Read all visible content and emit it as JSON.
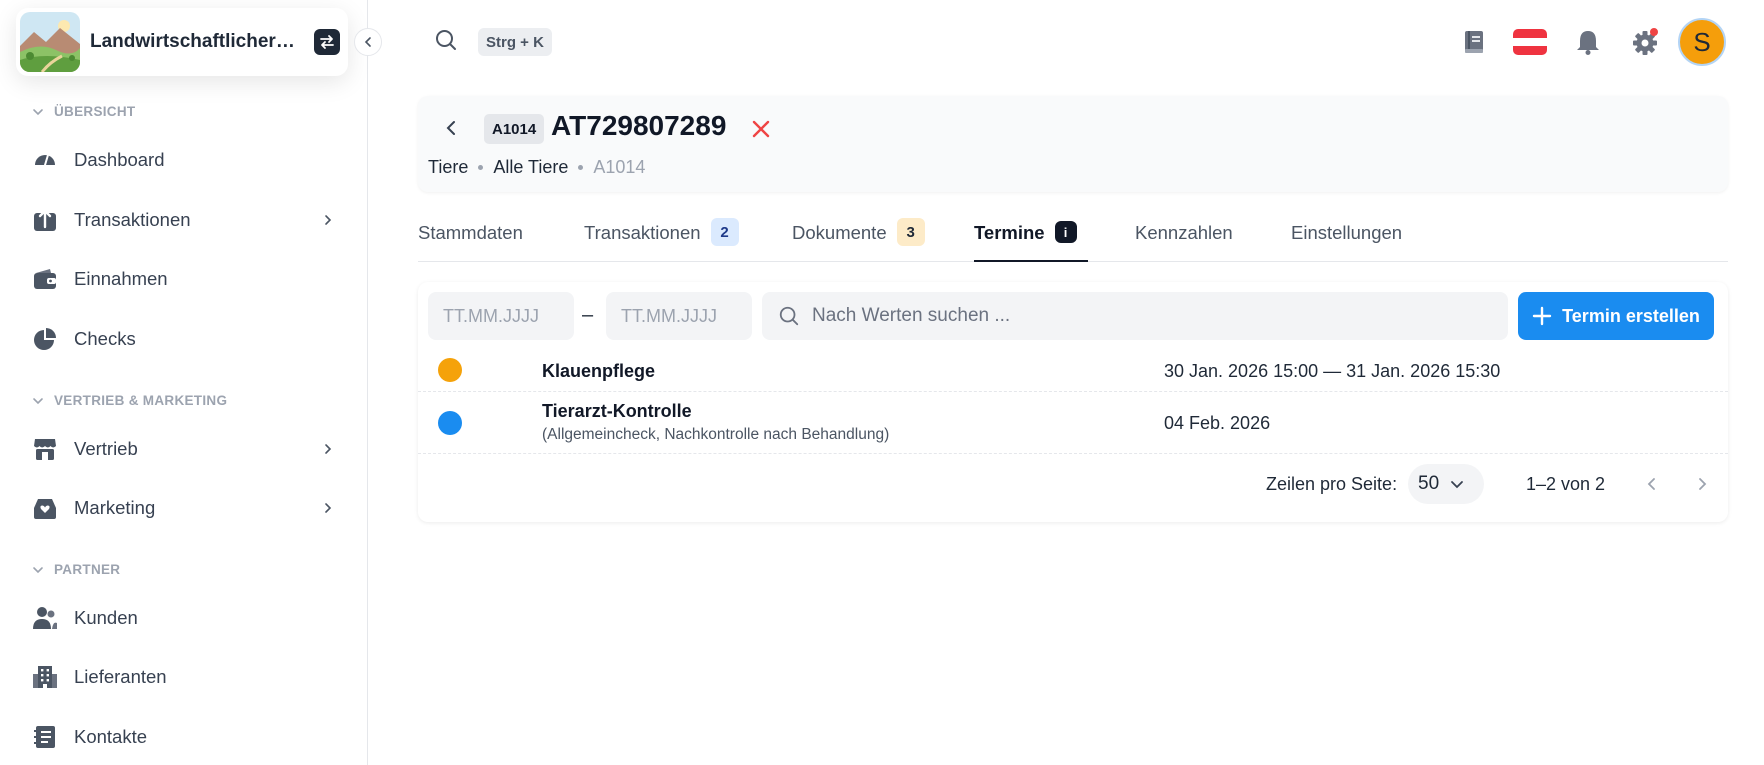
{
  "org": {
    "name": "Landwirtschaftlicher B..."
  },
  "sidebar": {
    "sections": [
      {
        "label": "ÜBERSICHT"
      },
      {
        "label": "VERTRIEB & MARKETING"
      },
      {
        "label": "PARTNER"
      }
    ],
    "items": [
      {
        "label": "Dashboard",
        "icon": "gauge-icon"
      },
      {
        "label": "Transaktionen",
        "icon": "transactions-icon"
      },
      {
        "label": "Einnahmen",
        "icon": "wallet-icon"
      },
      {
        "label": "Checks",
        "icon": "pie-chart-icon"
      },
      {
        "label": "Vertrieb",
        "icon": "store-icon"
      },
      {
        "label": "Marketing",
        "icon": "inbox-heart-icon"
      },
      {
        "label": "Kunden",
        "icon": "users-icon"
      },
      {
        "label": "Lieferanten",
        "icon": "building-icon"
      },
      {
        "label": "Kontakte",
        "icon": "address-book-icon"
      }
    ]
  },
  "topbar": {
    "shortcut": "Strg + K",
    "avatar_initial": "S",
    "notification_dot_color": "#ef4444"
  },
  "header": {
    "id_chip": "A1014",
    "title": "AT729807289",
    "breadcrumb": [
      "Tiere",
      "Alle Tiere",
      "A1014"
    ]
  },
  "tabs": [
    {
      "label": "Stammdaten"
    },
    {
      "label": "Transaktionen",
      "badge": "2"
    },
    {
      "label": "Dokumente",
      "badge": "3"
    },
    {
      "label": "Termine",
      "badge": "i",
      "active": true
    },
    {
      "label": "Kennzahlen"
    },
    {
      "label": "Einstellungen"
    }
  ],
  "filters": {
    "date_from_placeholder": "TT.MM.JJJJ",
    "date_to_placeholder": "TT.MM.JJJJ",
    "separator": "–",
    "search_placeholder": "Nach Werten suchen ...",
    "create_label": "Termin erstellen"
  },
  "events": [
    {
      "title": "Klauenpflege",
      "subtitle": "",
      "date": "30 Jan. 2026 15:00 — 31 Jan. 2026 15:30",
      "color": "#f5a20a"
    },
    {
      "title": "Tierarzt-Kontrolle",
      "subtitle": "(Allgemeincheck, Nachkontrolle nach Behandlung)",
      "date": "04 Feb. 2026",
      "color": "#1a8cf0"
    }
  ],
  "pagination": {
    "rows_label": "Zeilen pro Seite:",
    "rows_per_page": "50",
    "range": "1–2 von 2"
  },
  "colors": {
    "accent": "#1a8cf0",
    "danger": "#ef4444",
    "avatar": "#f59e0b"
  }
}
